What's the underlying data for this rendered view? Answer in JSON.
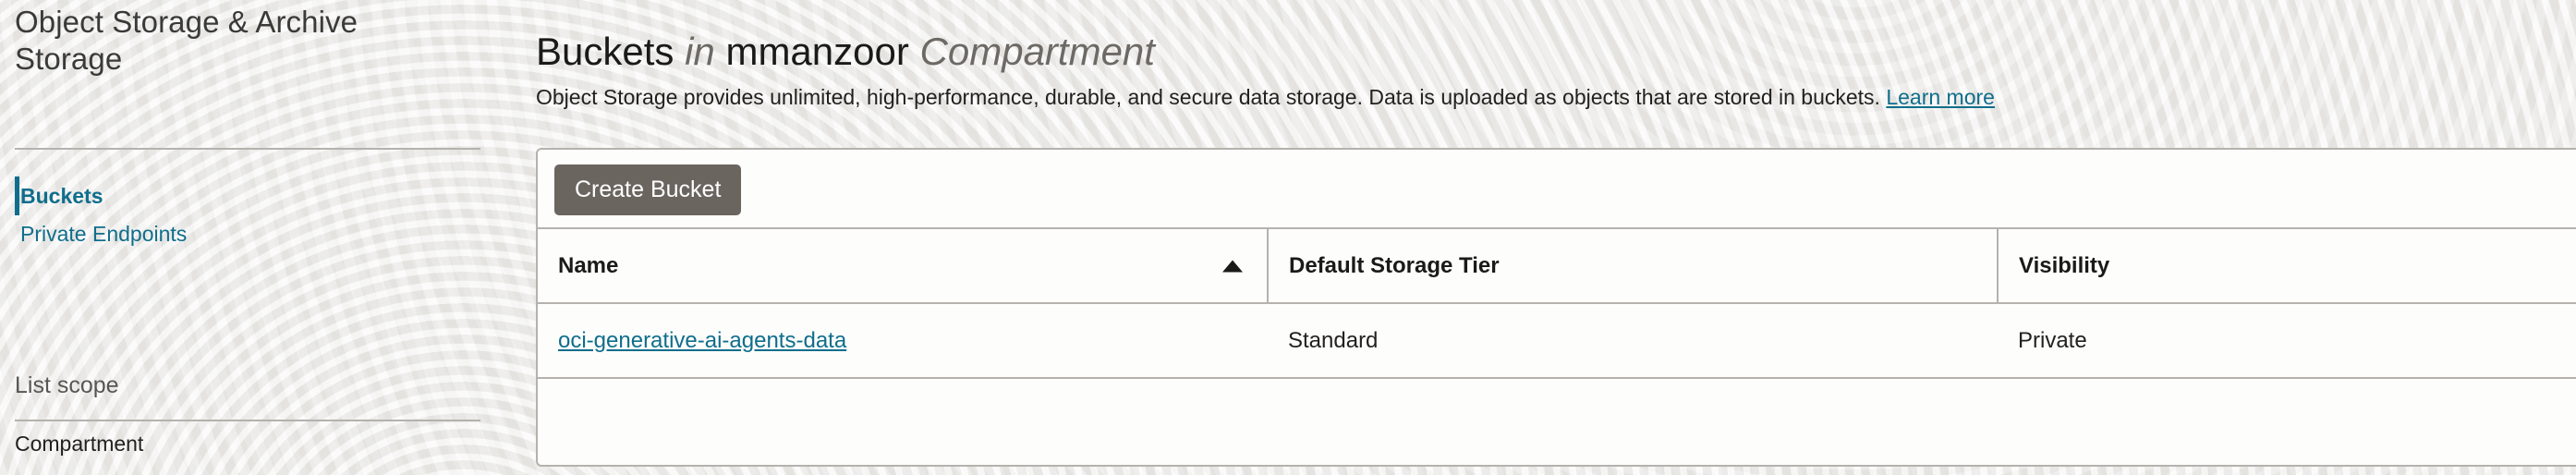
{
  "sidebar": {
    "service_title": "Object Storage & Archive Storage",
    "nav": [
      {
        "label": "Buckets",
        "active": true
      },
      {
        "label": "Private Endpoints",
        "active": false
      }
    ],
    "list_scope_label": "List scope",
    "compartment_label": "Compartment"
  },
  "header": {
    "title_main": "Buckets",
    "title_in": "in",
    "title_scope": "mmanzoor",
    "title_suffix": "Compartment",
    "description": "Object Storage provides unlimited, high-performance, durable, and secure data storage. Data is uploaded as objects that are stored in buckets.",
    "learn_more_label": "Learn more"
  },
  "toolbar": {
    "create_bucket_label": "Create Bucket"
  },
  "table": {
    "columns": [
      {
        "label": "Name",
        "sort": "asc"
      },
      {
        "label": "Default Storage Tier",
        "sort": null
      },
      {
        "label": "Visibility",
        "sort": null
      }
    ],
    "rows": [
      {
        "name": "oci-generative-ai-agents-data",
        "default_storage_tier": "Standard",
        "visibility": "Private"
      }
    ]
  },
  "colors": {
    "accent_link": "#0f6e8c",
    "button_bg": "#6b6560",
    "page_bg": "#edecea",
    "card_bg": "#fdfdfb",
    "border": "#b5b2ad"
  }
}
